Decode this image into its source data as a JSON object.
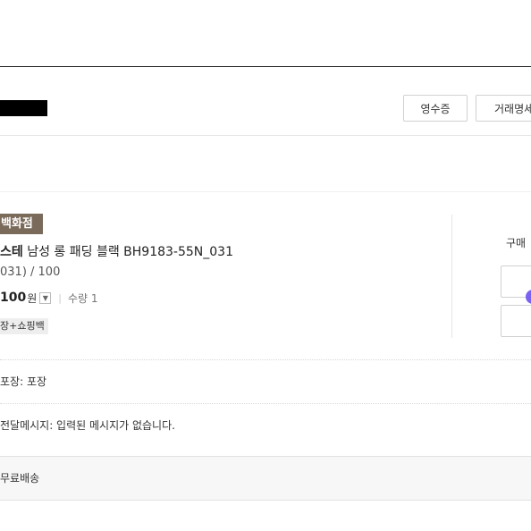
{
  "header": {
    "buttons": {
      "receipt": "영수증",
      "statement": "거래명세"
    }
  },
  "product": {
    "store_badge": "백화점",
    "brand": "스테",
    "name": " 남성 롱 패딩 블랙 BH9183-55N_031",
    "option": "031) / 100",
    "price": "100",
    "currency": "원",
    "separator": "|",
    "quantity": "수량 1",
    "gift_tag": "장+쇼핑백"
  },
  "side_panel": {
    "buy_label": "구매",
    "button_1_label": "",
    "button_2_label": ""
  },
  "details": {
    "packaging": "포장: 포장",
    "message": "전달메시지: 입력된 메시지가 없습니다.",
    "delivery": "무료배송"
  },
  "colors": {
    "store_badge_bg": "#7a6a5a",
    "accent_dot": "#7b61f0"
  }
}
